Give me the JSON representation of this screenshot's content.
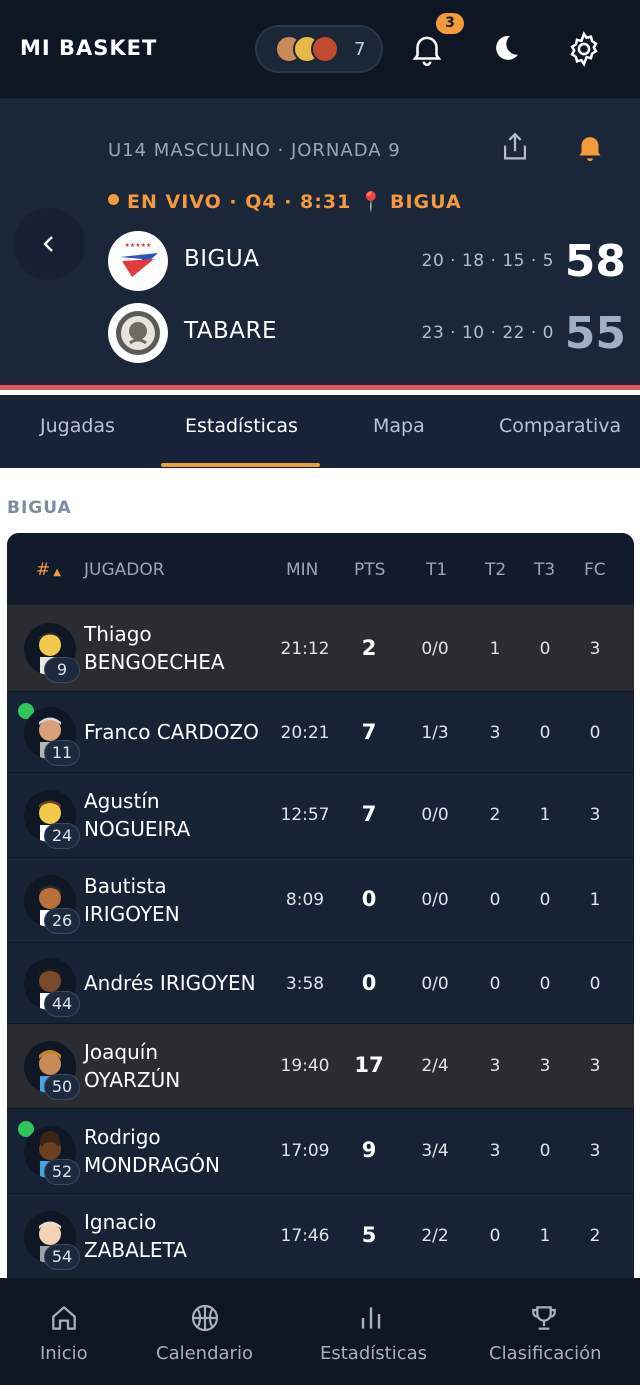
{
  "app": {
    "title": "MI BASKET",
    "following_count": "7",
    "notifications_badge": "3"
  },
  "match": {
    "league": "U14 MASCULINO · JORNADA 9",
    "status": "EN VIVO · Q4 · 8:31",
    "venue": "BIGUA",
    "home": {
      "name": "BIGUA",
      "quarters": "20 · 18 · 15 · 5",
      "score": "58"
    },
    "away": {
      "name": "TABARE",
      "quarters": "23 · 10 · 22 · 0",
      "score": "55"
    }
  },
  "tabs": [
    {
      "label": "Jugadas"
    },
    {
      "label": "Estadísticas"
    },
    {
      "label": "Mapa"
    },
    {
      "label": "Comparativa"
    }
  ],
  "stats": {
    "team": "BIGUA",
    "columns": {
      "num": "#",
      "player": "JUGADOR",
      "min": "MIN",
      "pts": "PTS",
      "t1": "T1",
      "t2": "T2",
      "t3": "T3",
      "fc": "FC"
    },
    "players": [
      {
        "first": "Thiago",
        "last": "BENGOECHEA",
        "num": "9",
        "min": "21:12",
        "pts": "2",
        "t1": "0/0",
        "t2": "1",
        "t3": "0",
        "fc": "3"
      },
      {
        "name": "Franco CARDOZO",
        "num": "11",
        "min": "20:21",
        "pts": "7",
        "t1": "1/3",
        "t2": "3",
        "t3": "0",
        "fc": "0"
      },
      {
        "first": "Agustín",
        "last": "NOGUEIRA",
        "num": "24",
        "min": "12:57",
        "pts": "7",
        "t1": "0/0",
        "t2": "2",
        "t3": "1",
        "fc": "3"
      },
      {
        "first": "Bautista",
        "last": "IRIGOYEN",
        "num": "26",
        "min": "8:09",
        "pts": "0",
        "t1": "0/0",
        "t2": "0",
        "t3": "0",
        "fc": "1"
      },
      {
        "name": "Andrés IRIGOYEN",
        "num": "44",
        "min": "3:58",
        "pts": "0",
        "t1": "0/0",
        "t2": "0",
        "t3": "0",
        "fc": "0"
      },
      {
        "first": "Joaquín",
        "last": "OYARZÚN",
        "num": "50",
        "min": "19:40",
        "pts": "17",
        "t1": "2/4",
        "t2": "3",
        "t3": "3",
        "fc": "3"
      },
      {
        "first": "Rodrigo",
        "last": "MONDRAGÓN",
        "num": "52",
        "min": "17:09",
        "pts": "9",
        "t1": "3/4",
        "t2": "3",
        "t3": "0",
        "fc": "3"
      },
      {
        "first": "Ignacio",
        "last": "ZABALETA",
        "num": "54",
        "min": "17:46",
        "pts": "5",
        "t1": "2/2",
        "t2": "0",
        "t3": "1",
        "fc": "2"
      }
    ]
  },
  "nav": [
    {
      "label": "Inicio",
      "icon": "home-icon"
    },
    {
      "label": "Calendario",
      "icon": "basketball-icon"
    },
    {
      "label": "Estadísticas",
      "icon": "bar-chart-icon"
    },
    {
      "label": "Clasificación",
      "icon": "trophy-icon"
    }
  ],
  "colors": {
    "accent": "#f39a3c",
    "live_red": "#e15656",
    "on_court": "#2fc55a",
    "pin": "#ee4a78"
  }
}
